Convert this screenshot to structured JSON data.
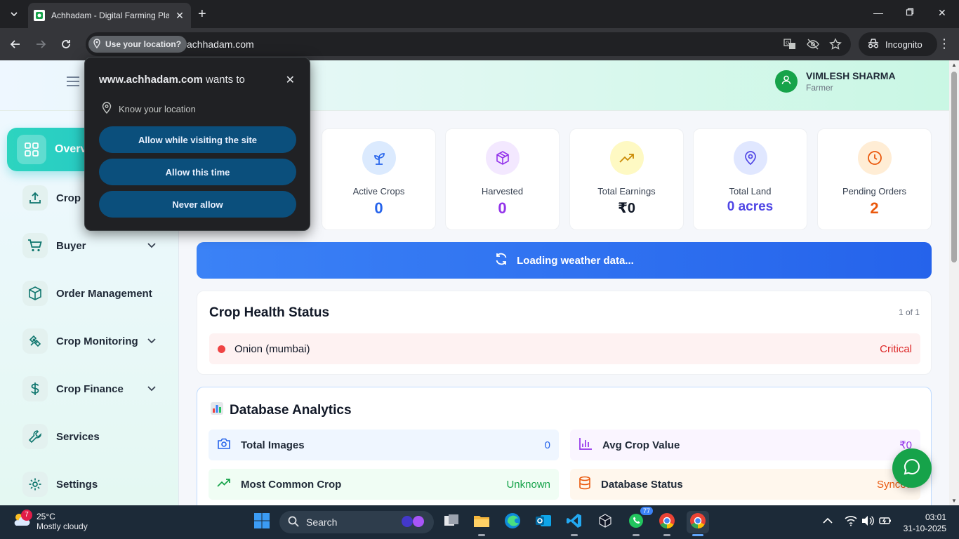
{
  "browser": {
    "tab_title": "Achhadam - Digital Farming Pla",
    "location_chip": "Use your location?",
    "url": "achhadam.com",
    "incognito_label": "Incognito"
  },
  "permission_popup": {
    "site": "www.achhadam.com",
    "wants_to": " wants to",
    "know_location": "Know your location",
    "allow_while_visiting": "Allow while visiting the site",
    "allow_this_time": "Allow this time",
    "never_allow": "Never allow"
  },
  "header": {
    "user_name": "VIMLESH SHARMA",
    "user_role": "Farmer"
  },
  "sidebar": {
    "items": [
      {
        "label": "Overview",
        "icon": "grid-icon",
        "active": true
      },
      {
        "label": "Crop Upload",
        "icon": "upload-icon"
      },
      {
        "label": "Buyer",
        "icon": "cart-icon",
        "has_dropdown": true
      },
      {
        "label": "Order Management",
        "icon": "box-icon"
      },
      {
        "label": "Crop Monitoring",
        "icon": "satellite-icon",
        "has_dropdown": true
      },
      {
        "label": "Crop Finance",
        "icon": "dollar-icon",
        "has_dropdown": true
      },
      {
        "label": "Services",
        "icon": "wrench-icon"
      },
      {
        "label": "Settings",
        "icon": "gear-icon"
      }
    ]
  },
  "stats": [
    {
      "label": "Active Crops",
      "value": "0",
      "color": "#2563eb",
      "icon": "sprout-icon",
      "bg": "#dbeafe"
    },
    {
      "label": "Harvested",
      "value": "0",
      "color": "#9333ea",
      "icon": "package-icon",
      "bg": "#f3e8ff"
    },
    {
      "label": "Total Earnings",
      "value": "₹0",
      "color": "#111827",
      "icon": "trending-up-icon",
      "bg": "#fef9c3"
    },
    {
      "label": "Total Land",
      "value": "0 acres",
      "color": "#4f46e5",
      "icon": "map-pin-icon",
      "bg": "#e0e7ff"
    },
    {
      "label": "Pending Orders",
      "value": "2",
      "color": "#ea580c",
      "icon": "clock-icon",
      "bg": "#ffedd5"
    }
  ],
  "weather_banner": "Loading weather data...",
  "crop_health": {
    "title": "Crop Health Status",
    "count": "1 of 1",
    "rows": [
      {
        "crop": "Onion (mumbai)",
        "status": "Critical"
      }
    ]
  },
  "analytics": {
    "title": "Database Analytics",
    "tiles": [
      {
        "label": "Total Images",
        "value": "0"
      },
      {
        "label": "Avg Crop Value",
        "value": "₹0"
      },
      {
        "label": "Most Common Crop",
        "value": "Unknown"
      },
      {
        "label": "Database Status",
        "value": "Synced"
      }
    ]
  },
  "taskbar": {
    "temp": "25°C",
    "condition": "Mostly cloudy",
    "weather_badge": "7",
    "search": "Search",
    "whatsapp_badge": "77",
    "time": "03:01",
    "date": "31-10-2025"
  },
  "colors": {
    "accent_teal": "#2dd4bf",
    "weather_blue": "#2563eb",
    "critical_red": "#dc2626",
    "brand_green": "#16a34a"
  }
}
